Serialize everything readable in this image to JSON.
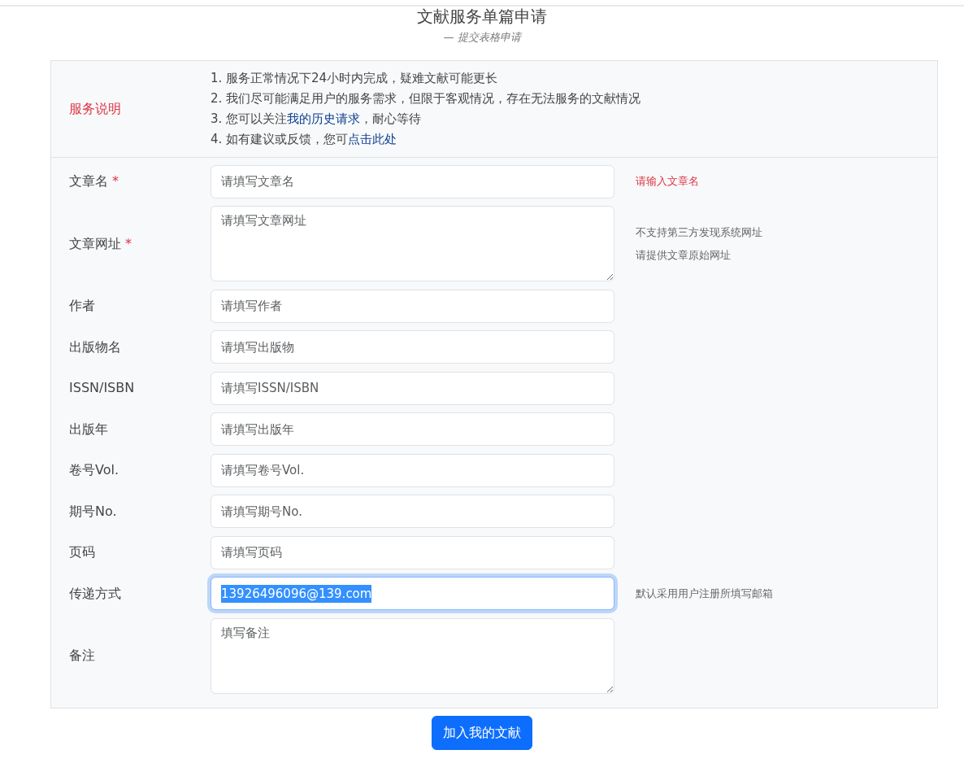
{
  "header": {
    "title": "文献服务单篇申请",
    "subtitle": "— 提交表格申请"
  },
  "notice": {
    "label": "服务说明",
    "items": [
      [
        {
          "text": "1. 服务正常情况下24小时内完成，疑难文献可能更长",
          "link": false
        }
      ],
      [
        {
          "text": "2. 我们尽可能满足用户的服务需求，但限于客观情况，存在无法服务的文献情况",
          "link": false
        }
      ],
      [
        {
          "text": "3. 您可以关注",
          "link": false
        },
        {
          "text": "我的历史请求",
          "link": true
        },
        {
          "text": "，耐心等待",
          "link": false
        }
      ],
      [
        {
          "text": "4. 如有建议或反馈，您可",
          "link": false
        },
        {
          "text": "点击此处",
          "link": true
        }
      ]
    ]
  },
  "fields": [
    {
      "label": "文章名",
      "required_mark": "*",
      "kind": "input",
      "placeholder": "请填写文章名",
      "focused": false,
      "hints": [
        {
          "text": "请输入文章名",
          "kind": "error"
        }
      ]
    },
    {
      "label": "文章网址",
      "required_mark": "*",
      "kind": "textarea",
      "placeholder": "请填写文章网址",
      "focused": false,
      "hints": [
        {
          "text": "不支持第三方发现系统网址",
          "kind": "muted"
        },
        {
          "text": "请提供文章原始网址",
          "kind": "muted"
        }
      ]
    },
    {
      "label": "作者",
      "kind": "input",
      "placeholder": "请填写作者",
      "focused": false
    },
    {
      "label": "出版物名",
      "kind": "input",
      "placeholder": "请填写出版物",
      "focused": false
    },
    {
      "label": "ISSN/ISBN",
      "kind": "input",
      "placeholder": "请填写ISSN/ISBN",
      "focused": false
    },
    {
      "label": "出版年",
      "kind": "input",
      "placeholder": "请填写出版年",
      "focused": false
    },
    {
      "label": "卷号Vol.",
      "kind": "input",
      "placeholder": "请填写卷号Vol.",
      "focused": false
    },
    {
      "label": "期号No.",
      "kind": "input",
      "placeholder": "请填写期号No.",
      "focused": false
    },
    {
      "label": "页码",
      "kind": "input",
      "placeholder": "请填写页码",
      "focused": false
    },
    {
      "label": "传递方式",
      "kind": "input",
      "value": "13926496096@139.com",
      "focused": true,
      "hints": [
        {
          "text": "默认采用用户注册所填写邮箱",
          "kind": "muted"
        }
      ]
    },
    {
      "label": "备注",
      "kind": "textarea",
      "placeholder": "填写备注",
      "focused": false
    }
  ],
  "submit": "加入我的文献"
}
